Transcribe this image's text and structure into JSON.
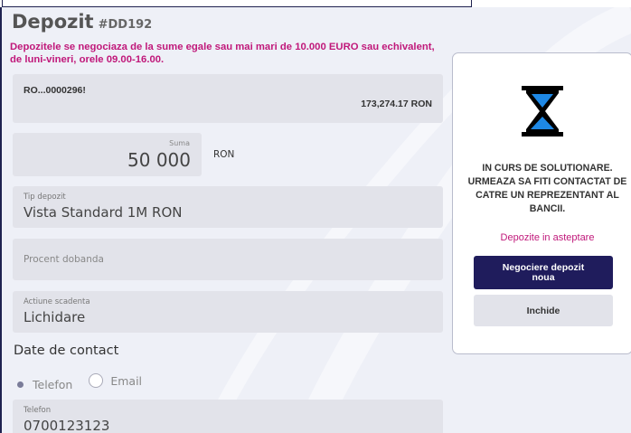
{
  "header": {
    "title": "Depozit",
    "code": "#DD192"
  },
  "notice": "Depozitele se negociaza de la sume egale sau mai mari de 10.000 EURO sau echivalent, de luni-vineri, orele 09.00-16.00.",
  "account": {
    "iban": "RO...0000296!",
    "balance": "173,274.17 RON"
  },
  "amount": {
    "label": "Suma",
    "value": "50 000",
    "currency": "RON"
  },
  "deposit_type": {
    "label": "Tip depozit",
    "value": "Vista Standard 1M RON"
  },
  "interest": {
    "placeholder": "Procent dobanda"
  },
  "maturity": {
    "label": "Actiune scadenta",
    "value": "Lichidare"
  },
  "contact": {
    "title": "Date de contact",
    "options": [
      {
        "label": "Telefon",
        "selected": true
      },
      {
        "label": "Email",
        "selected": false
      }
    ],
    "phone_label": "Telefon",
    "phone_value": "0700123123"
  },
  "panel": {
    "icon": "hourglass-icon",
    "status": "IN CURS DE SOLUTIONARE. URMEAZA SA FITI CONTACTAT DE CATRE UN REPREZENTANT AL BANCII.",
    "pending_link": "Depozite in asteptare",
    "primary_button": "Negociere depozit noua",
    "secondary_button": "Inchide"
  },
  "colors": {
    "accent": "#c0187a",
    "primary": "#1f1c5c",
    "icon_blue": "#1e88e5"
  }
}
